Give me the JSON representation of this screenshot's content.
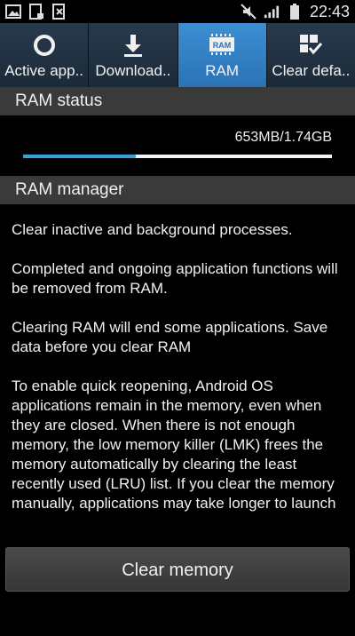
{
  "status_bar": {
    "time": "22:43",
    "left_icons": [
      "picture-icon",
      "download-icon",
      "notification-icon"
    ],
    "right_icons": [
      "mute-icon",
      "signal-icon",
      "battery-icon"
    ]
  },
  "tabs": [
    {
      "label": "Active app..",
      "icon": "ring-icon",
      "active": false
    },
    {
      "label": "Download..",
      "icon": "download-icon",
      "active": false
    },
    {
      "label": "RAM",
      "icon": "ram-chip-icon",
      "icon_text": "RAM",
      "active": true
    },
    {
      "label": "Clear defa..",
      "icon": "clear-defaults-icon",
      "active": false
    }
  ],
  "ram_status": {
    "header": "RAM status",
    "usage_text": "653MB/1.74GB",
    "used_fraction": 0.366
  },
  "ram_manager": {
    "header": "RAM manager",
    "paragraphs": [
      "Clear inactive and background processes.",
      "Completed and ongoing application functions will be removed from RAM.",
      "Clearing RAM will end some applications. Save data before you clear RAM",
      "To enable quick reopening, Android OS applications remain in the memory, even when they are closed. When there is not enough memory, the low memory killer (LMK) frees the memory automatically by clearing the least recently used (LRU) list. If you clear the memory manually, applications may take longer to launch"
    ]
  },
  "clear_button_label": "Clear memory",
  "colors": {
    "accent": "#36a3d6",
    "active_tab": "#3d8ed2",
    "tab_bg": "#233444",
    "section_bg": "#3a3a3a"
  }
}
